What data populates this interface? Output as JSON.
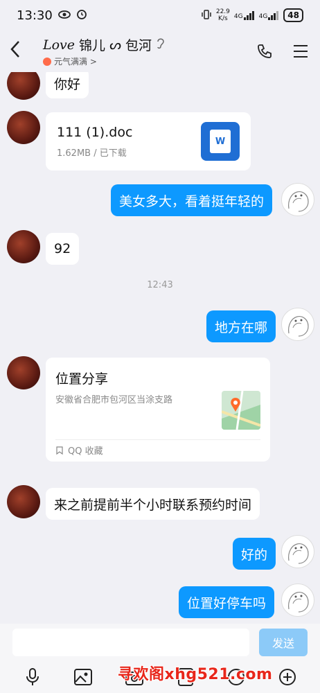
{
  "status_bar": {
    "time": "13:30",
    "net_speed": "22.9\nK/s",
    "net_speed_top": "22.9",
    "net_speed_bottom": "K/s",
    "signal1": "4G",
    "signal2": "4G",
    "battery": "48"
  },
  "header": {
    "title_prefix": "Love",
    "title_name": "锦儿",
    "title_suffix": "包河",
    "subtitle": "元气满满 >"
  },
  "messages": [
    {
      "type": "text",
      "direction": "in",
      "text": "你好"
    },
    {
      "type": "file",
      "direction": "in",
      "file_name": "111 (1).doc",
      "file_meta": "1.62MB / 已下载",
      "file_icon_label": "W"
    },
    {
      "type": "text",
      "direction": "out",
      "text": "美女多大，看着挺年轻的"
    },
    {
      "type": "text",
      "direction": "in",
      "text": "92"
    },
    {
      "type": "time",
      "text": "12:43"
    },
    {
      "type": "text",
      "direction": "out",
      "text": "地方在哪"
    },
    {
      "type": "location",
      "direction": "in",
      "title": "位置分享",
      "address": "安徽省合肥市包河区当涂支路",
      "footer": "QQ 收藏"
    },
    {
      "type": "text",
      "direction": "in",
      "text": "来之前提前半个小时联系预约时间"
    },
    {
      "type": "text",
      "direction": "out",
      "text": "好的"
    },
    {
      "type": "text",
      "direction": "out",
      "text": "位置好停车吗"
    }
  ],
  "input": {
    "value": "",
    "placeholder": "",
    "send_label": "发送"
  },
  "toolbar": {
    "icons": [
      "microphone-icon",
      "image-icon",
      "camera-icon",
      "red-packet-icon",
      "emoji-icon",
      "plus-icon"
    ]
  },
  "watermark": "寻欢阁xhg521.com",
  "colors": {
    "outgoing_bubble": "#0d99ff",
    "incoming_bubble": "#ffffff",
    "background": "#f0f0f5",
    "send_button": "#8ccaf8",
    "watermark": "#e8261a"
  }
}
